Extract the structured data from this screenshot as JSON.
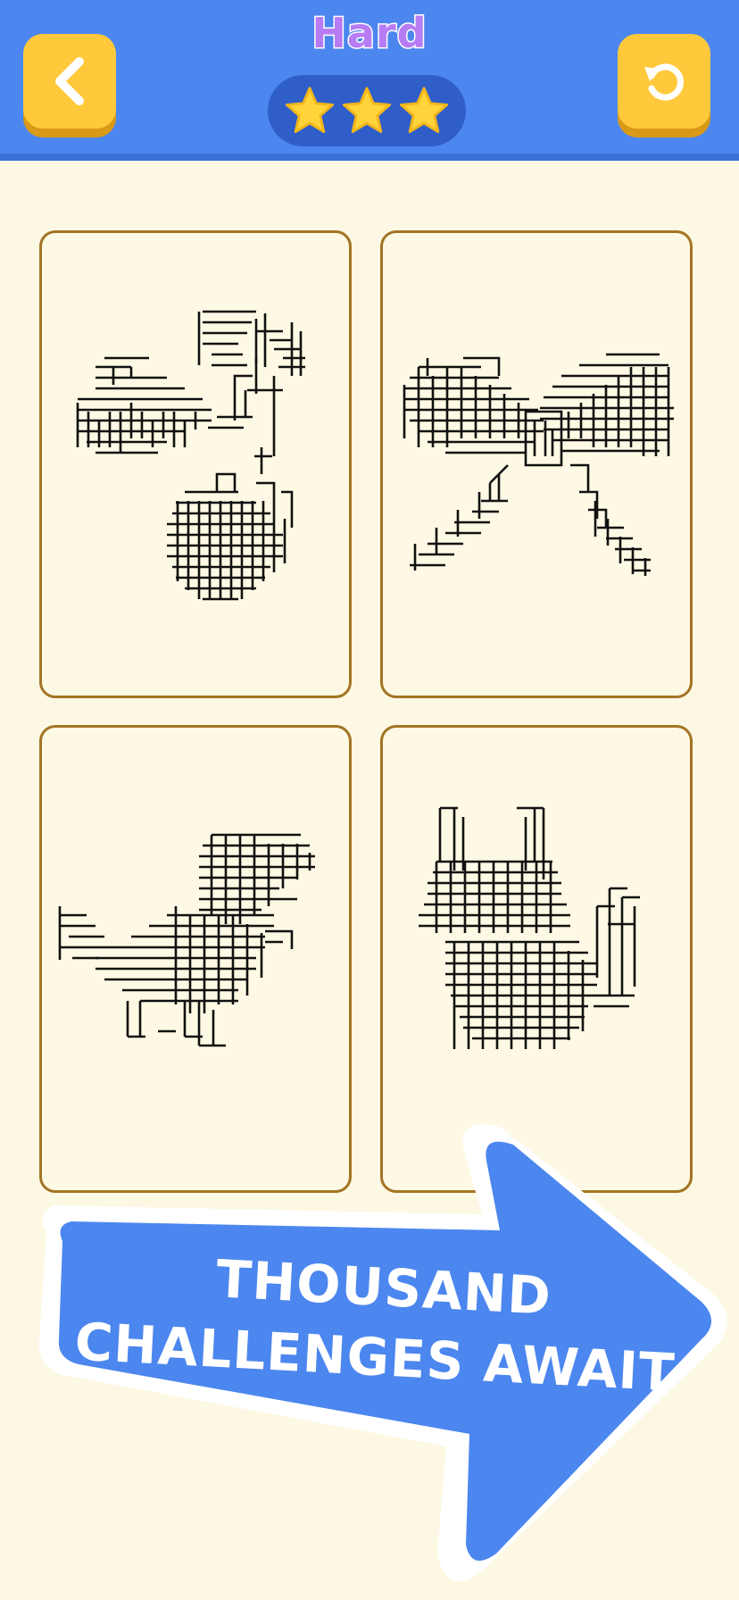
{
  "header": {
    "level_title": "Hard",
    "stars_earned": 3,
    "back_icon": "chevron-left-icon",
    "restart_icon": "restart-icon"
  },
  "colors": {
    "header_bg": "#4c86ef",
    "button_yellow": "#ffc93b",
    "star_gold": "#ffd43b",
    "card_border": "#a37424",
    "page_bg": "#fcf8e3",
    "banner_blue": "#4c86ef"
  },
  "puzzles": [
    {
      "name": "cherries"
    },
    {
      "name": "bow"
    },
    {
      "name": "dinosaur"
    },
    {
      "name": "cat"
    }
  ],
  "banner": {
    "line1": "THOUSAND",
    "line2": "CHALLENGES AWAIT"
  }
}
